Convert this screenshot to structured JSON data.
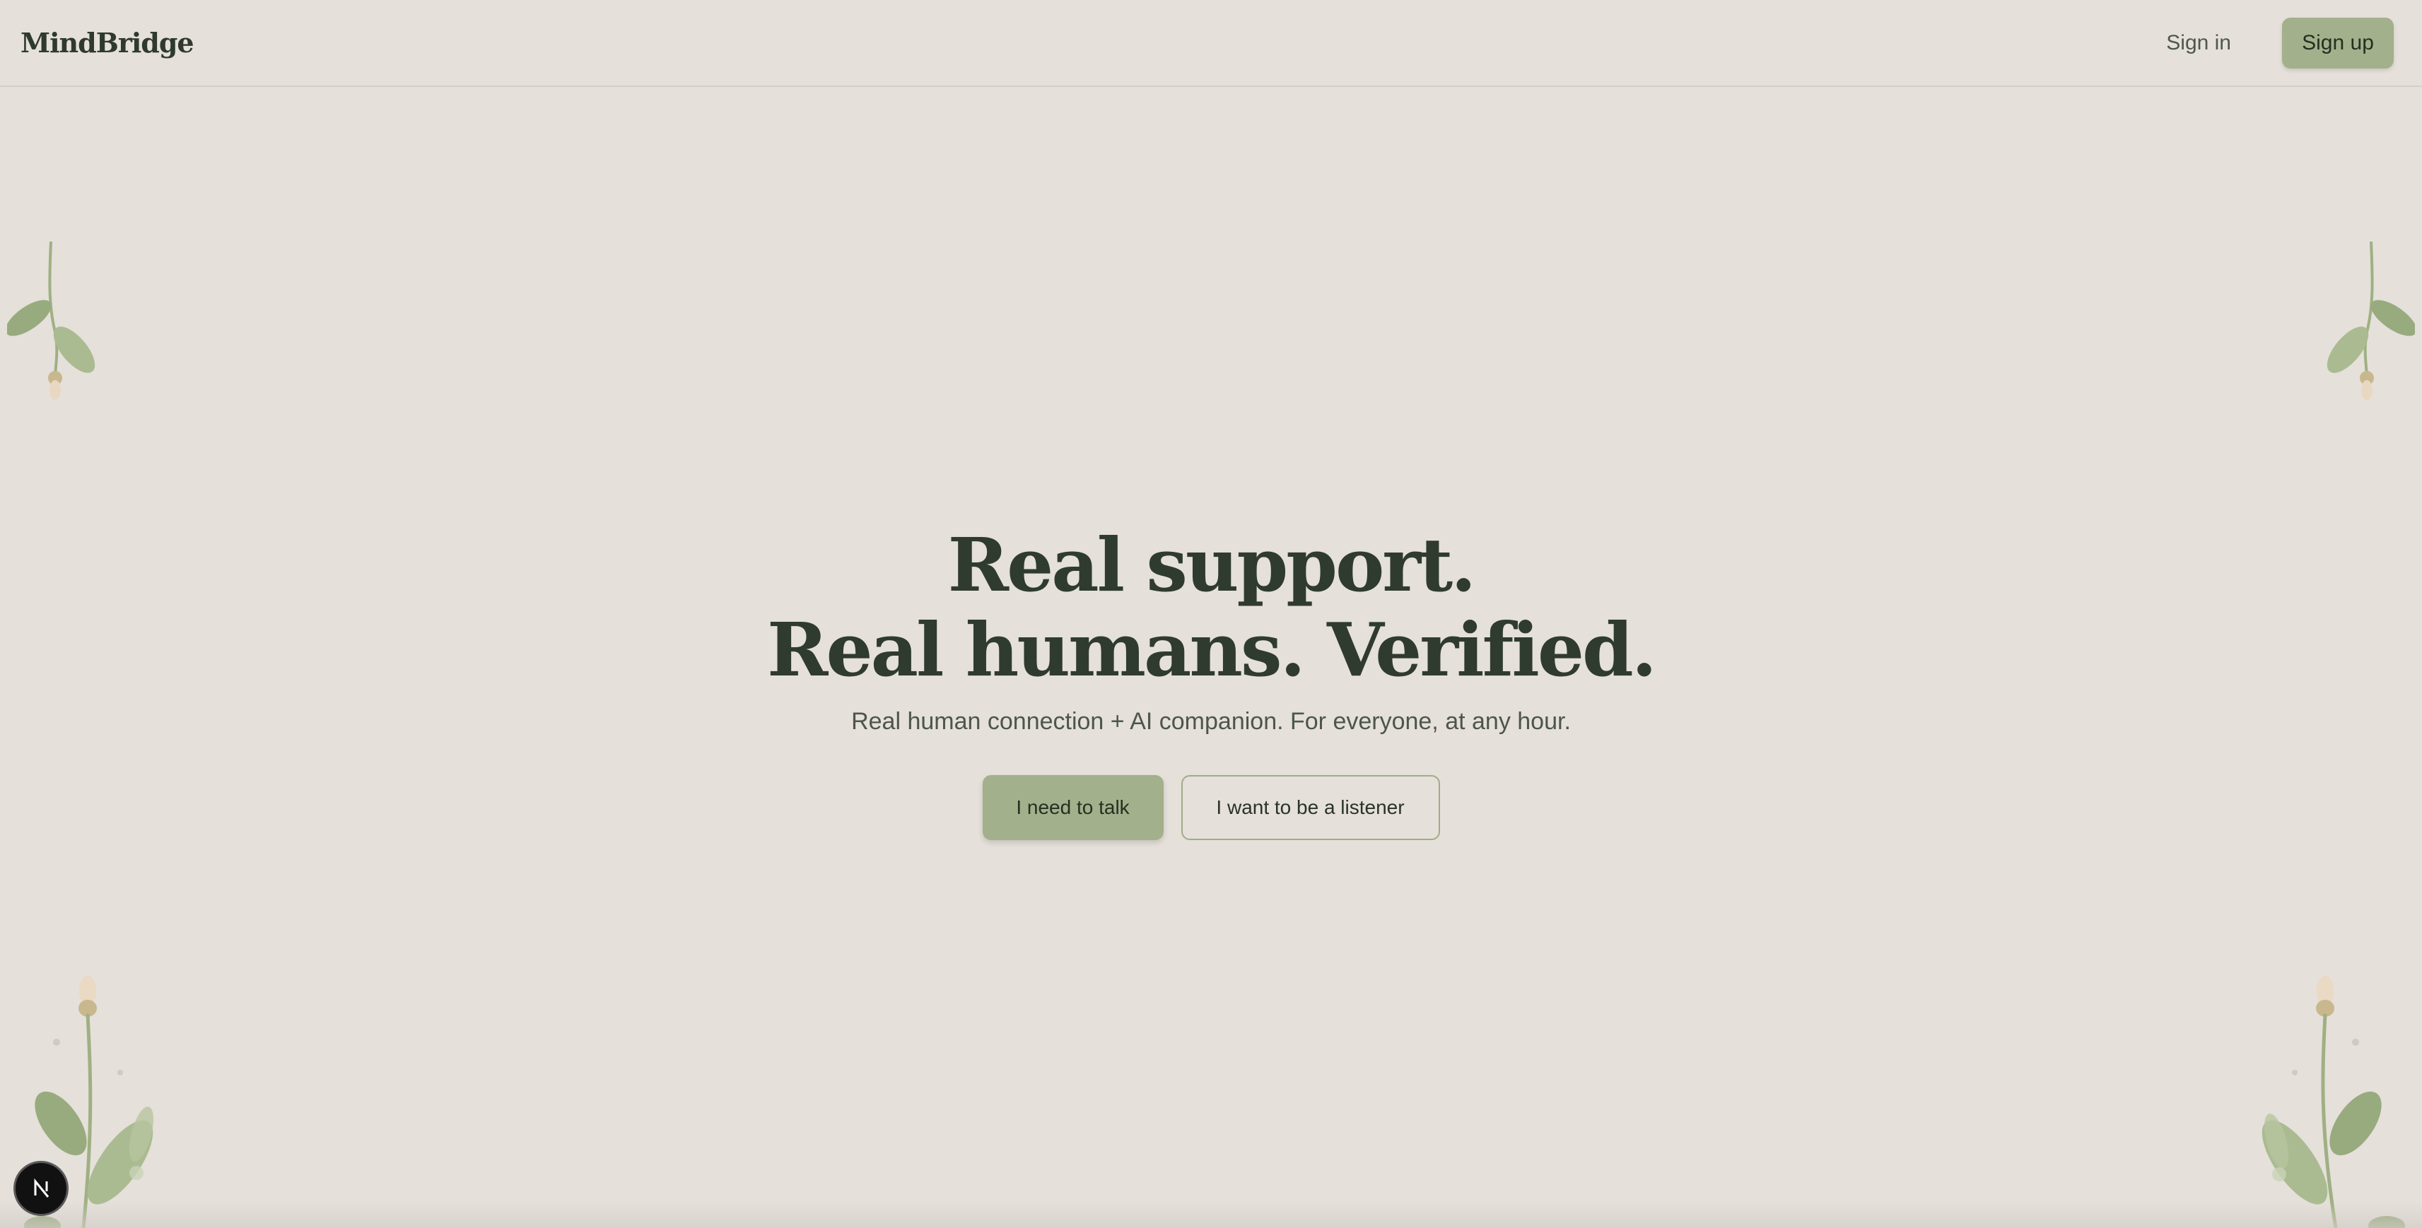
{
  "header": {
    "logo": "MindBridge",
    "signin_label": "Sign in",
    "signup_label": "Sign up"
  },
  "hero": {
    "title_line1": "Real support.",
    "title_line2": "Real humans. Verified.",
    "subtitle": "Real human connection + AI companion. For everyone, at any hour.",
    "primary_cta": "I need to talk",
    "secondary_cta": "I want to be a listener"
  },
  "fab": {
    "label": "N",
    "icon": "nextjs-icon"
  },
  "colors": {
    "background": "#e5e0da",
    "accent": "#a2b08c",
    "text_dark": "#2f3b2e",
    "leaf": "#9fb083"
  }
}
